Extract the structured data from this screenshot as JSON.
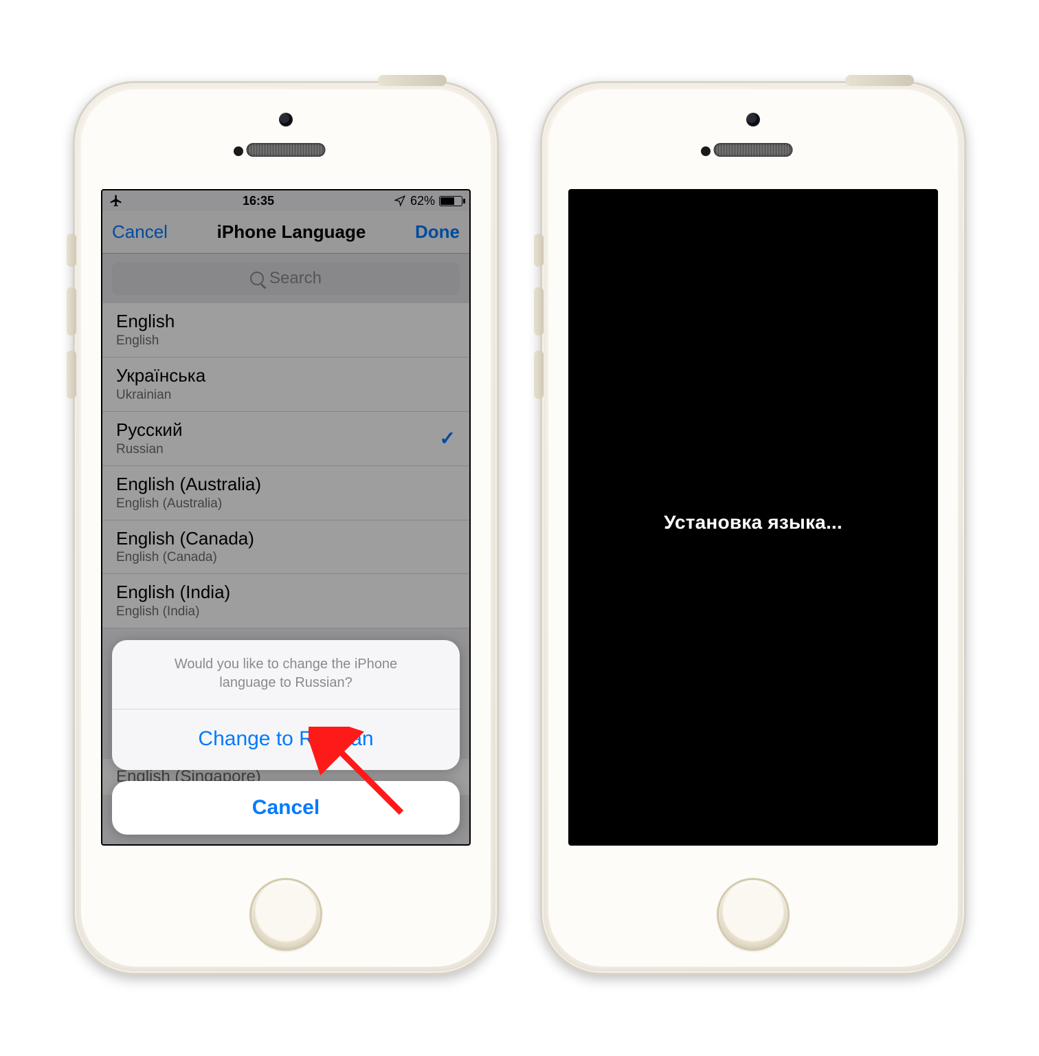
{
  "statusbar": {
    "time": "16:35",
    "battery_pct": "62%"
  },
  "nav": {
    "cancel": "Cancel",
    "title": "iPhone Language",
    "done": "Done"
  },
  "search": {
    "placeholder": "Search"
  },
  "languages": [
    {
      "native": "English",
      "sub": "English",
      "selected": false
    },
    {
      "native": "Українська",
      "sub": "Ukrainian",
      "selected": false
    },
    {
      "native": "Русский",
      "sub": "Russian",
      "selected": true
    },
    {
      "native": "English (Australia)",
      "sub": "English (Australia)",
      "selected": false
    },
    {
      "native": "English (Canada)",
      "sub": "English (Canada)",
      "selected": false
    },
    {
      "native": "English (India)",
      "sub": "English (India)",
      "selected": false
    }
  ],
  "peek_row": "English (Singapore)",
  "sheet": {
    "message_line1": "Would you like to change the iPhone",
    "message_line2": "language to Russian?",
    "action": "Change to Russian",
    "cancel": "Cancel"
  },
  "right_screen": {
    "text": "Установка языка..."
  },
  "colors": {
    "ios_blue": "#007aff"
  }
}
